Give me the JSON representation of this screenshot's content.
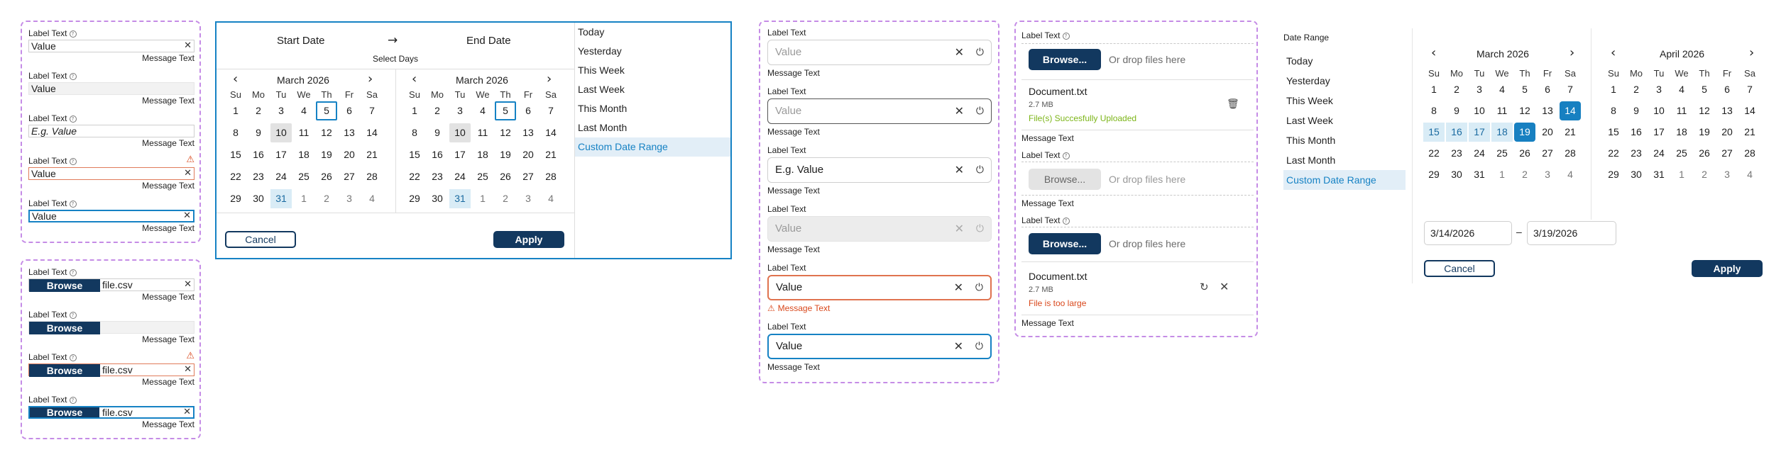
{
  "simple_inputs": [
    {
      "label": "Label Text",
      "value": "Value",
      "message": "Message Text",
      "state": "default"
    },
    {
      "label": "Label Text",
      "value": "Value",
      "message": "Message Text",
      "state": "disabled"
    },
    {
      "label": "Label Text",
      "value": "E.g. Value",
      "message": "Message Text",
      "state": "placeholder"
    },
    {
      "label": "Label Text",
      "value": "Value",
      "message": "Message Text",
      "state": "error"
    },
    {
      "label": "Label Text",
      "value": "Value",
      "message": "Message Text",
      "state": "focused"
    }
  ],
  "file_inputs": [
    {
      "label": "Label Text",
      "browse": "Browse",
      "file": "file.csv",
      "message": "Message Text",
      "state": "default"
    },
    {
      "label": "Label Text",
      "browse": "Browse",
      "file": "",
      "message": "Message Text",
      "state": "empty"
    },
    {
      "label": "Label Text",
      "browse": "Browse",
      "file": "file.csv",
      "message": "Message Text",
      "state": "error"
    },
    {
      "label": "Label Text",
      "browse": "Browse",
      "file": "file.csv",
      "message": "Message Text",
      "state": "focused"
    }
  ],
  "picker1": {
    "start_label": "Start Date",
    "arrow": "→",
    "end_label": "End Date",
    "subtitle": "Select Days",
    "left_month": "March 2026",
    "right_month": "March 2026",
    "weekdays": [
      "Su",
      "Mo",
      "Tu",
      "We",
      "Th",
      "Fr",
      "Sa"
    ],
    "days": [
      "1",
      "2",
      "3",
      "4",
      "5",
      "6",
      "7",
      "8",
      "9",
      "10",
      "11",
      "12",
      "13",
      "14",
      "15",
      "16",
      "17",
      "18",
      "19",
      "20",
      "21",
      "22",
      "23",
      "24",
      "25",
      "26",
      "27",
      "28",
      "29",
      "30",
      "31",
      "1",
      "2",
      "3",
      "4"
    ],
    "quick": [
      "Today",
      "Yesterday",
      "This Week",
      "Last Week",
      "This Month",
      "Last Month",
      "Custom Date Range"
    ],
    "cancel": "Cancel",
    "apply": "Apply"
  },
  "medium_inputs": [
    {
      "label": "Label Text",
      "value": "Value",
      "message": "Message Text",
      "state": "default"
    },
    {
      "label": "Label Text",
      "value": "Value",
      "message": "Message Text",
      "state": "hover"
    },
    {
      "label": "Label Text",
      "value": "E.g. Value",
      "message": "Message Text",
      "state": "placeholder"
    },
    {
      "label": "Label Text",
      "value": "Value",
      "message": "Message Text",
      "state": "disabled"
    },
    {
      "label": "Label Text",
      "value": "Value",
      "message": "Message Text",
      "state": "error"
    },
    {
      "label": "Label Text",
      "value": "Value",
      "message": "Message Text",
      "state": "focused"
    }
  ],
  "uploads": {
    "label": "Label Text",
    "browse": "Browse...",
    "drop": "Or drop files here",
    "message": "Message Text",
    "file1": {
      "name": "Document.txt",
      "size": "2.7 MB",
      "status": "File(s) Succesfully Uploaded"
    },
    "file2": {
      "name": "Document.txt",
      "size": "2.7 MB",
      "status": "File is too large"
    }
  },
  "picker2": {
    "title": "Date Range",
    "quick": [
      "Today",
      "Yesterday",
      "This Week",
      "Last Week",
      "This Month",
      "Last Month",
      "Custom Date Range"
    ],
    "left_month": "March 2026",
    "right_month": "April 2026",
    "weekdays": [
      "Su",
      "Mo",
      "Tu",
      "We",
      "Th",
      "Fr",
      "Sa"
    ],
    "march_days": [
      "1",
      "2",
      "3",
      "4",
      "5",
      "6",
      "7",
      "8",
      "9",
      "10",
      "11",
      "12",
      "13",
      "14",
      "15",
      "16",
      "17",
      "18",
      "19",
      "20",
      "21",
      "22",
      "23",
      "24",
      "25",
      "26",
      "27",
      "28",
      "29",
      "30",
      "31",
      "1",
      "2",
      "3",
      "4"
    ],
    "april_days": [
      "1",
      "2",
      "3",
      "4",
      "5",
      "6",
      "7",
      "8",
      "9",
      "10",
      "11",
      "12",
      "13",
      "14",
      "15",
      "16",
      "17",
      "18",
      "19",
      "20",
      "21",
      "22",
      "23",
      "24",
      "25",
      "26",
      "27",
      "28",
      "29",
      "30",
      "31",
      "1",
      "2",
      "3",
      "4"
    ],
    "start_value": "3/14/2026",
    "dash": "–",
    "end_value": "3/19/2026",
    "cancel": "Cancel",
    "apply": "Apply"
  },
  "colors": {
    "primary": "#12385f",
    "focus": "#1682c4",
    "error": "#d9481c",
    "success": "#7cb518",
    "dashed": "#c58ce6"
  }
}
